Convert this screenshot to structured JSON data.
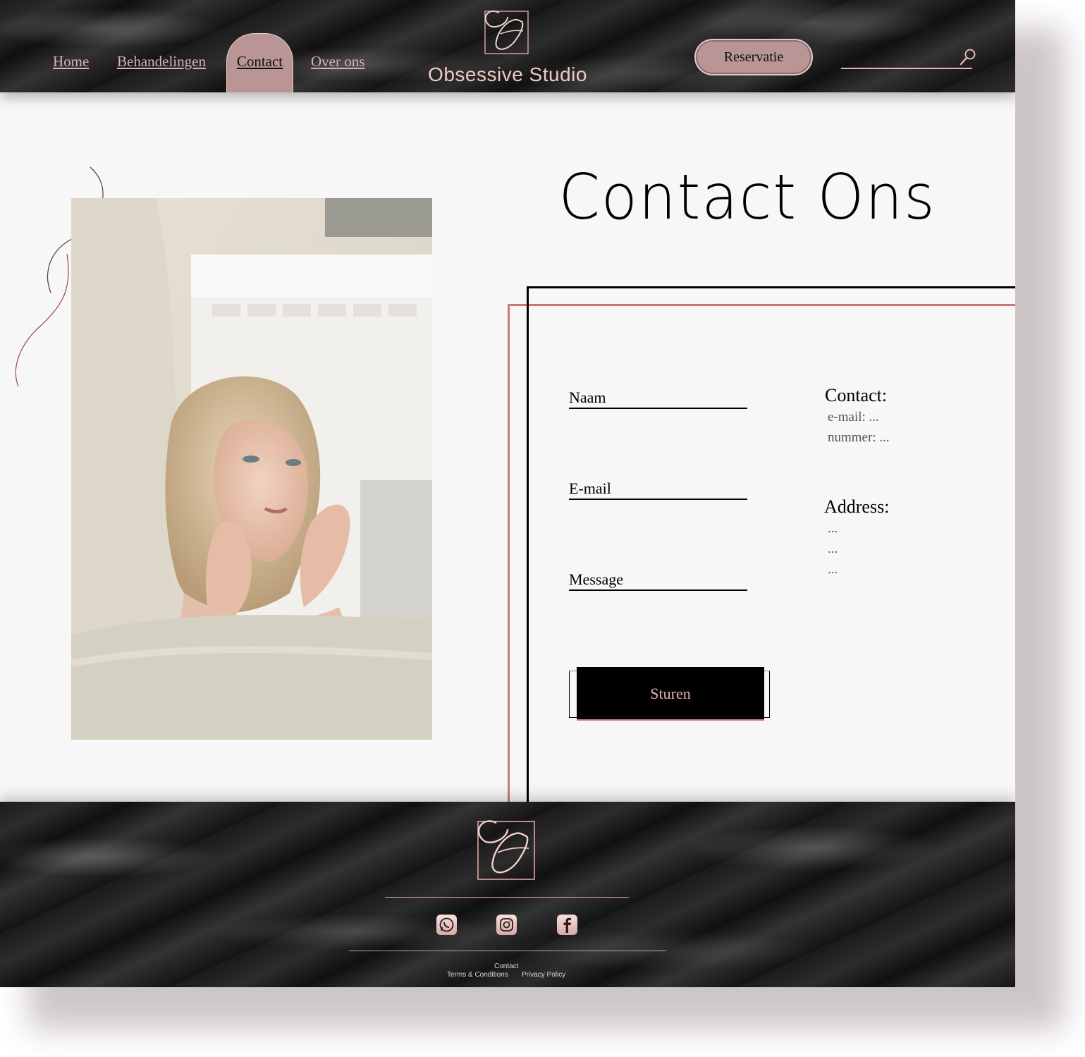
{
  "colors": {
    "accent_pink": "#efc9c4",
    "accent_rose": "#b99596",
    "frame_pink": "#cf7777",
    "dark": "#1a1a1a",
    "page_bg": "#f7f7f7"
  },
  "header": {
    "brand": "Obsessive Studio",
    "nav": {
      "home": "Home",
      "treatments": "Behandelingen",
      "contact": "Contact",
      "about": "Over ons"
    },
    "active_nav": "Contact",
    "reserve_label": "Reservatie",
    "search_placeholder": "",
    "search_icon": "search-icon"
  },
  "main": {
    "title": "Contact Ons",
    "form": {
      "name_label": "Naam",
      "email_label": "E-mail",
      "message_label": "Message",
      "submit_label": "Sturen"
    },
    "info": {
      "contact_heading": "Contact:",
      "email_line": "e-mail: ...",
      "phone_line": "nummer: ...",
      "address_heading": "Address:",
      "address_lines": [
        "...",
        "...",
        "..."
      ]
    }
  },
  "footer": {
    "social_icons": [
      "whatsapp-icon",
      "instagram-icon",
      "facebook-icon"
    ],
    "links": {
      "contact": "Contact",
      "terms": "Terms & Conditions",
      "privacy": "Privacy Policy"
    }
  }
}
